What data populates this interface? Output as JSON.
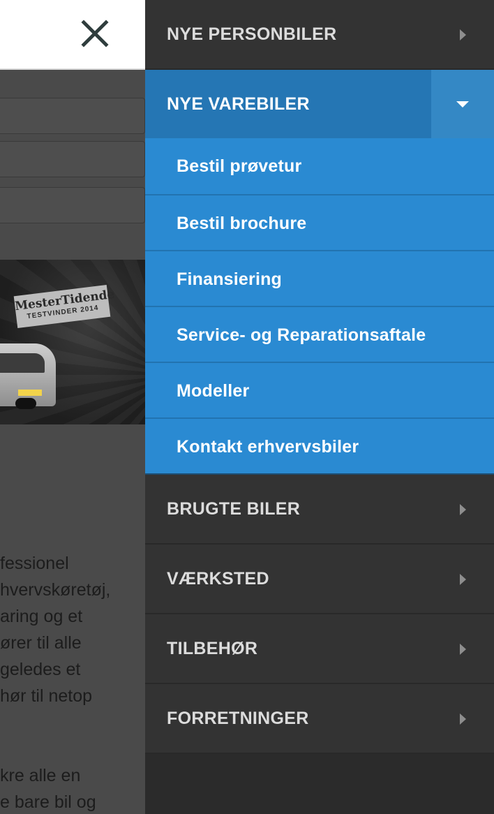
{
  "header": {
    "close_icon": "close-icon"
  },
  "banner": {
    "badge_title": "MesterTidende",
    "badge_subtitle": "TESTVINDER 2014"
  },
  "background_text": [
    "fessionel",
    "hvervskøretøj,",
    "aring og et",
    "ører til alle",
    "geledes et",
    "hør til netop",
    "",
    "",
    "kre alle en",
    "e bare bil og"
  ],
  "menu": {
    "items": [
      {
        "label": "NYE PERSONBILER",
        "icon": "chevron-right-icon"
      },
      {
        "label": "NYE VAREBILER",
        "icon": "caret-down-icon",
        "expanded": true,
        "children": [
          {
            "label": "Bestil prøvetur"
          },
          {
            "label": "Bestil brochure"
          },
          {
            "label": "Finansiering"
          },
          {
            "label": "Service- og Reparationsaftale"
          },
          {
            "label": "Modeller"
          },
          {
            "label": "Kontakt erhvervsbiler"
          }
        ]
      },
      {
        "label": "BRUGTE BILER",
        "icon": "chevron-right-icon"
      },
      {
        "label": "VÆRKSTED",
        "icon": "chevron-right-icon"
      },
      {
        "label": "TILBEHØR",
        "icon": "chevron-right-icon"
      },
      {
        "label": "FORRETNINGER",
        "icon": "chevron-right-icon"
      }
    ]
  },
  "colors": {
    "menu_bg": "#333333",
    "active_bg": "#2576b4",
    "submenu_bg": "#2a8ad2",
    "toggle_bg": "#3488c5",
    "overlay_bg": "#4a4a4a"
  }
}
